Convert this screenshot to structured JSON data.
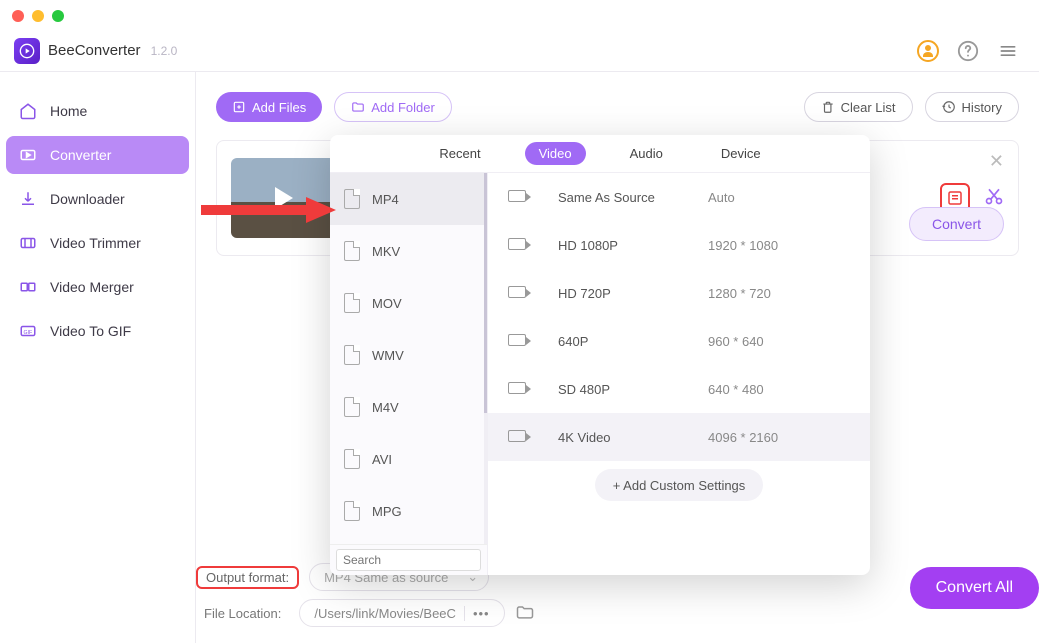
{
  "app": {
    "name": "BeeConverter",
    "version": "1.2.0"
  },
  "sidebar": {
    "items": [
      {
        "label": "Home"
      },
      {
        "label": "Converter"
      },
      {
        "label": "Downloader"
      },
      {
        "label": "Video Trimmer"
      },
      {
        "label": "Video Merger"
      },
      {
        "label": "Video To GIF"
      }
    ]
  },
  "toolbar": {
    "add_files": "Add Files",
    "add_folder": "Add Folder",
    "clear_list": "Clear List",
    "history": "History"
  },
  "file": {
    "convert": "Convert"
  },
  "popup": {
    "tabs": {
      "recent": "Recent",
      "video": "Video",
      "audio": "Audio",
      "device": "Device"
    },
    "formats": [
      {
        "label": "MP4"
      },
      {
        "label": "MKV"
      },
      {
        "label": "MOV"
      },
      {
        "label": "WMV"
      },
      {
        "label": "M4V"
      },
      {
        "label": "AVI"
      },
      {
        "label": "MPG"
      }
    ],
    "search_placeholder": "Search",
    "resolutions": [
      {
        "name": "Same As Source",
        "dim": "Auto"
      },
      {
        "name": "HD 1080P",
        "dim": "1920 * 1080"
      },
      {
        "name": "HD 720P",
        "dim": "1280 * 720"
      },
      {
        "name": "640P",
        "dim": "960 * 640"
      },
      {
        "name": "SD 480P",
        "dim": "640 * 480"
      },
      {
        "name": "4K Video",
        "dim": "4096 * 2160"
      }
    ],
    "custom": "+ Add Custom Settings"
  },
  "bottom": {
    "output_format_label": "Output format:",
    "output_format_value": "MP4 Same as source",
    "file_location_label": "File Location:",
    "file_location_value": "/Users/link/Movies/BeeC",
    "dots": "•••",
    "convert_all": "Convert All"
  }
}
